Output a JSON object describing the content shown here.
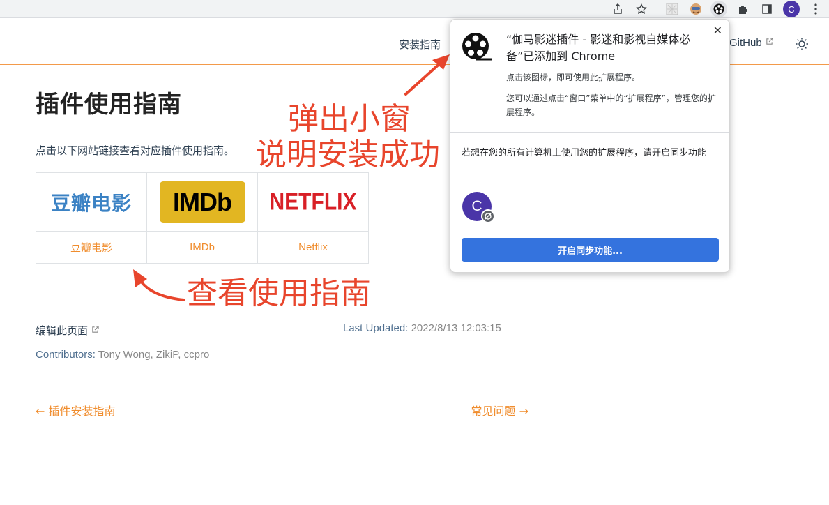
{
  "site": {
    "nav": {
      "install_guide": "安装指南",
      "github": "GitHub"
    },
    "title": "插件使用指南",
    "intro": "点击以下网站链接查看对应插件使用指南。",
    "sites": [
      {
        "logo_text": "豆瓣电影",
        "link": "豆瓣电影"
      },
      {
        "logo_text": "IMDb",
        "link": "IMDb"
      },
      {
        "logo_text": "NETFLIX",
        "link": "Netflix"
      }
    ],
    "edit_link": "编辑此页面",
    "last_updated_label": "Last Updated:",
    "last_updated_value": "2022/8/13 12:03:15",
    "contributors_label": "Contributors:",
    "contributors_value": "Tony Wong, ZikiP, ccpro",
    "prev_link": "← 插件安装指南",
    "next_link": "常见问题 →"
  },
  "browser": {
    "avatar_letter": "C"
  },
  "popup": {
    "title": "“伽马影迷插件 - 影迷和影视自媒体必备”已添加到 Chrome",
    "line1": "点击该图标，即可使用此扩展程序。",
    "line2": "您可以通过点击“窗口”菜单中的“扩展程序”，管理您的扩展程序。",
    "sync_text": "若想在您的所有计算机上使用您的扩展程序，请开启同步功能",
    "avatar_letter": "C",
    "button": "开启同步功能...",
    "close": "✕"
  },
  "annotations": {
    "popup_line1": "弹出小窗",
    "popup_line2": "说明安装成功",
    "guide": "查看使用指南"
  },
  "colors": {
    "accent": "#f08d2e",
    "annotation": "#e8452c",
    "button": "#3473de"
  }
}
